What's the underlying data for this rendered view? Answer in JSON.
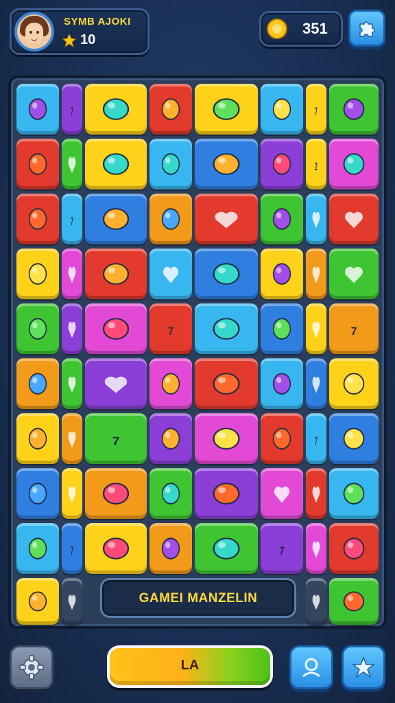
{
  "player": {
    "name": "SYMB AJOKI",
    "coins": "10",
    "avatar_icon": "girl-avatar-icon"
  },
  "score": {
    "value": "351",
    "icon": "gold-badge-icon"
  },
  "header_button_icon": "puzzle-icon",
  "board": {
    "title": "GAMEI MANZELIN",
    "tiles": [
      {
        "icon": "green-orb",
        "color": "#38b6f0"
      },
      {
        "icon": "seven",
        "color": "#8b3fd6"
      },
      {
        "icon": "macaron-heart",
        "color": "#ffd21a"
      },
      {
        "icon": "green-arrow",
        "color": "#e23a2c"
      },
      {
        "icon": "pencils",
        "color": "#ffd21a"
      },
      {
        "icon": "purple-bubble",
        "color": "#38b6f0"
      },
      {
        "icon": "seven",
        "color": "#ffd21a"
      },
      {
        "icon": "blue-brush",
        "color": "#3fc432"
      },
      {
        "icon": "cat-face",
        "color": "#e23a2c"
      },
      {
        "icon": "heart",
        "color": "#3fc432"
      },
      {
        "icon": "candy",
        "color": "#ffd21a"
      },
      {
        "icon": "plum",
        "color": "#38b6f0"
      },
      {
        "icon": "seven-star",
        "color": "#2f7fe0"
      },
      {
        "icon": "sun-face",
        "color": "#8b3fd6"
      },
      {
        "icon": "two",
        "color": "#ffd21a"
      },
      {
        "icon": "mushroom",
        "color": "#e24ad6"
      },
      {
        "icon": "lollipop",
        "color": "#e23a2c"
      },
      {
        "icon": "seven",
        "color": "#38b6f0"
      },
      {
        "icon": "duck",
        "color": "#2f7fe0"
      },
      {
        "icon": "blob-face",
        "color": "#f29a1a"
      },
      {
        "icon": "heart",
        "color": "#e23a2c"
      },
      {
        "icon": "green-bubble",
        "color": "#3fc432"
      },
      {
        "icon": "balloon",
        "color": "#38b6f0"
      },
      {
        "icon": "heart",
        "color": "#e23a2c"
      },
      {
        "icon": "robot-face",
        "color": "#ffd21a"
      }
    ]
  },
  "play_button": {
    "label": "LA"
  },
  "footer_icons": [
    "gear-icon",
    "profile-icon",
    "star-icon"
  ]
}
